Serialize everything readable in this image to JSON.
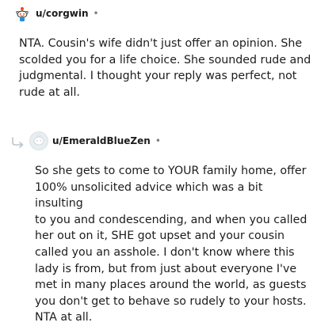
{
  "colors": {
    "text": "#1c1c1c",
    "muted": "#7c7c7c",
    "reply_arrow": "#b8c5ce",
    "avatar_bg": "#e8eef1"
  },
  "comments": [
    {
      "author": "u/corgwin",
      "separator": "•",
      "avatar_icon": "snoo-avatar-icon",
      "body_lines": [
        "NTA. Cousin's wife didn't just offer an opinion. She",
        "scolded you for a life choice. She sounded rude and",
        "judgmental. I thought your reply was perfect, not",
        "rude at all."
      ]
    },
    {
      "author": "u/EmeraldBlueZen",
      "separator": "•",
      "avatar_icon": "default-avatar-icon",
      "reply_icon": "reply-arrow-icon",
      "body_lines": [
        "So she gets to come to YOUR family home, offer",
        "100% unsolicited advice which was a bit insulting",
        "to you and condescending, and when you called",
        "her out on it, SHE got upset and your cousin",
        "called you an asshole. I don't know where this",
        "lady is from, but from just about everyone I've",
        "met in many places around the world, as guests",
        "you don't get to behave so rudely to your hosts.",
        "NTA at all."
      ]
    }
  ]
}
